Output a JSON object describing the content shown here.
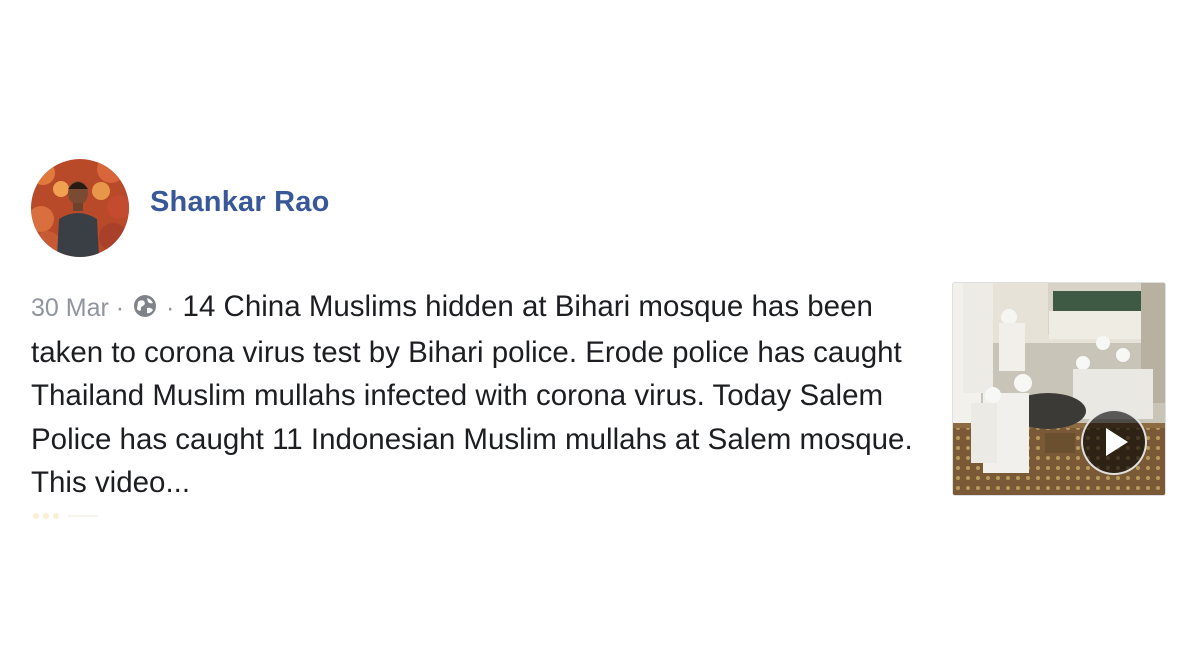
{
  "post": {
    "author": "Shankar Rao",
    "date": "30 Mar",
    "separator": "·",
    "privacy_icon": "globe-icon",
    "text": "14 China Muslims hidden at Bihari mosque has been taken to corona virus test by Bihari police. Erode police has caught Thailand Muslim mullahs infected with corona virus. Today Salem Police has caught 11 Indonesian Muslim mullahs at Salem mosque. This video...",
    "video_thumbnail_icon": "play-icon"
  },
  "colors": {
    "author_link": "#385898",
    "meta_text": "#90949c",
    "body_text": "#1c1e21"
  }
}
